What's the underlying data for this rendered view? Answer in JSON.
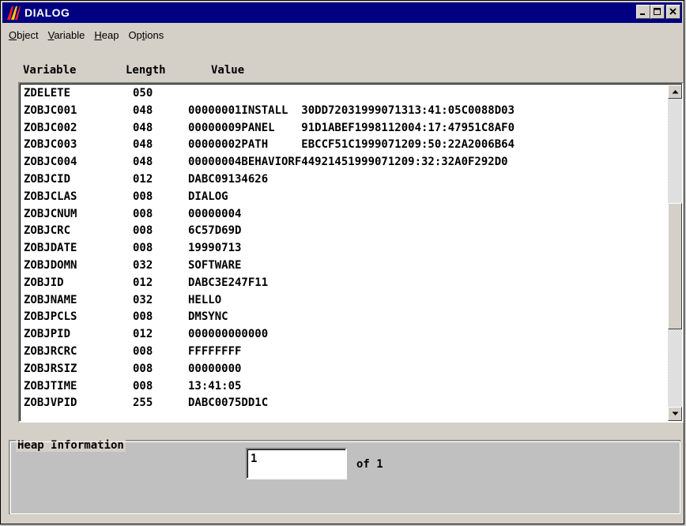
{
  "window": {
    "title": "DIALOG",
    "title_bar_color": "#000080"
  },
  "controls": {
    "minimize": "_",
    "maximize": "□",
    "close": "×"
  },
  "menu": [
    {
      "pre": "",
      "ul": "O",
      "post": "bject"
    },
    {
      "pre": "",
      "ul": "V",
      "post": "ariable"
    },
    {
      "pre": "",
      "ul": "H",
      "post": "eap"
    },
    {
      "pre": "Op",
      "ul": "t",
      "post": "ions"
    }
  ],
  "columns": {
    "variable": "Variable",
    "length": "Length",
    "value": "Value"
  },
  "rows": [
    {
      "name": "ZDELETE",
      "length": "050",
      "value": ""
    },
    {
      "name": "ZOBJC001",
      "length": "048",
      "value": "00000001INSTALL  30DD72031999071313:41:05C0088D03"
    },
    {
      "name": "ZOBJC002",
      "length": "048",
      "value": "00000009PANEL    91D1ABEF1998112004:17:47951C8AF0"
    },
    {
      "name": "ZOBJC003",
      "length": "048",
      "value": "00000002PATH     EBCCF51C1999071209:50:22A2006B64"
    },
    {
      "name": "ZOBJC004",
      "length": "048",
      "value": "00000004BEHAVIORF44921451999071209:32:32A0F292D0"
    },
    {
      "name": "ZOBJCID",
      "length": "012",
      "value": "DABC09134626"
    },
    {
      "name": "ZOBJCLAS",
      "length": "008",
      "value": "DIALOG"
    },
    {
      "name": "ZOBJCNUM",
      "length": "008",
      "value": "00000004"
    },
    {
      "name": "ZOBJCRC",
      "length": "008",
      "value": "6C57D69D"
    },
    {
      "name": "ZOBJDATE",
      "length": "008",
      "value": "19990713"
    },
    {
      "name": "ZOBJDOMN",
      "length": "032",
      "value": "SOFTWARE"
    },
    {
      "name": "ZOBJID",
      "length": "012",
      "value": "DABC3E247F11"
    },
    {
      "name": "ZOBJNAME",
      "length": "032",
      "value": "HELLO"
    },
    {
      "name": "ZOBJPCLS",
      "length": "008",
      "value": "DMSYNC"
    },
    {
      "name": "ZOBJPID",
      "length": "012",
      "value": "000000000000"
    },
    {
      "name": "ZOBJRCRC",
      "length": "008",
      "value": "FFFFFFFF"
    },
    {
      "name": "ZOBJRSIZ",
      "length": "008",
      "value": "00000000"
    },
    {
      "name": "ZOBJTIME",
      "length": "008",
      "value": "13:41:05"
    },
    {
      "name": "ZOBJVPID",
      "length": "255",
      "value": "DABC0075DD1C"
    }
  ],
  "heap": {
    "label": "Heap Information",
    "value": "1",
    "of_text": "of 1"
  }
}
